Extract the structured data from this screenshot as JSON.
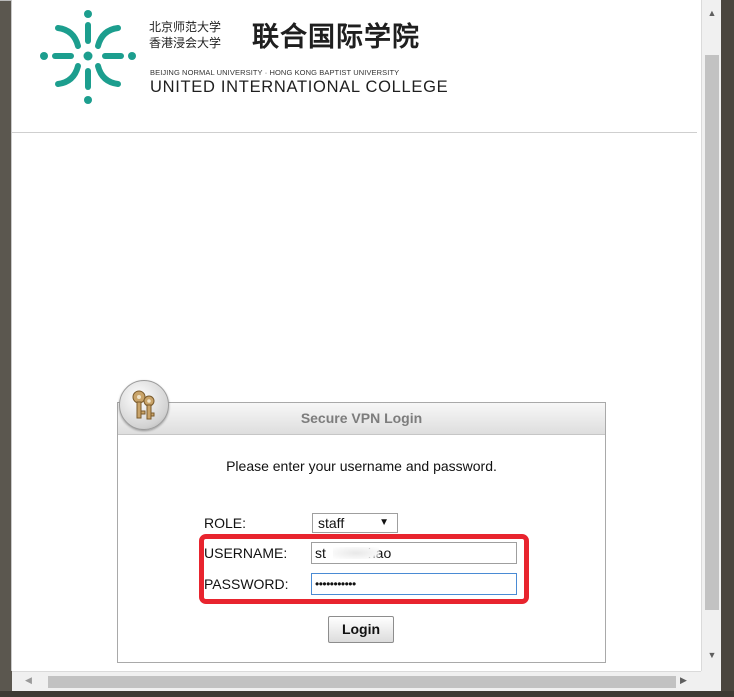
{
  "header": {
    "cn_small_line1": "北京师范大学",
    "cn_small_line2": "香港浸会大学",
    "cn_big": "联合国际学院",
    "en_small": "BEIJING NORMAL UNIVERSITY · HONG KONG BAPTIST UNIVERSITY",
    "en_big": "UNITED INTERNATIONAL COLLEGE",
    "logo_color": "#1c9e8e"
  },
  "login": {
    "title": "Secure VPN Login",
    "instructions": "Please enter your username and password.",
    "role_label": "ROLE:",
    "role_value": "staff",
    "username_label": "USERNAME:",
    "username_value_start": "st",
    "username_value_end": "hao",
    "password_label": "PASSWORD:",
    "password_value": "•••••••••••",
    "login_button": "Login",
    "highlight_color": "#e8242e"
  }
}
